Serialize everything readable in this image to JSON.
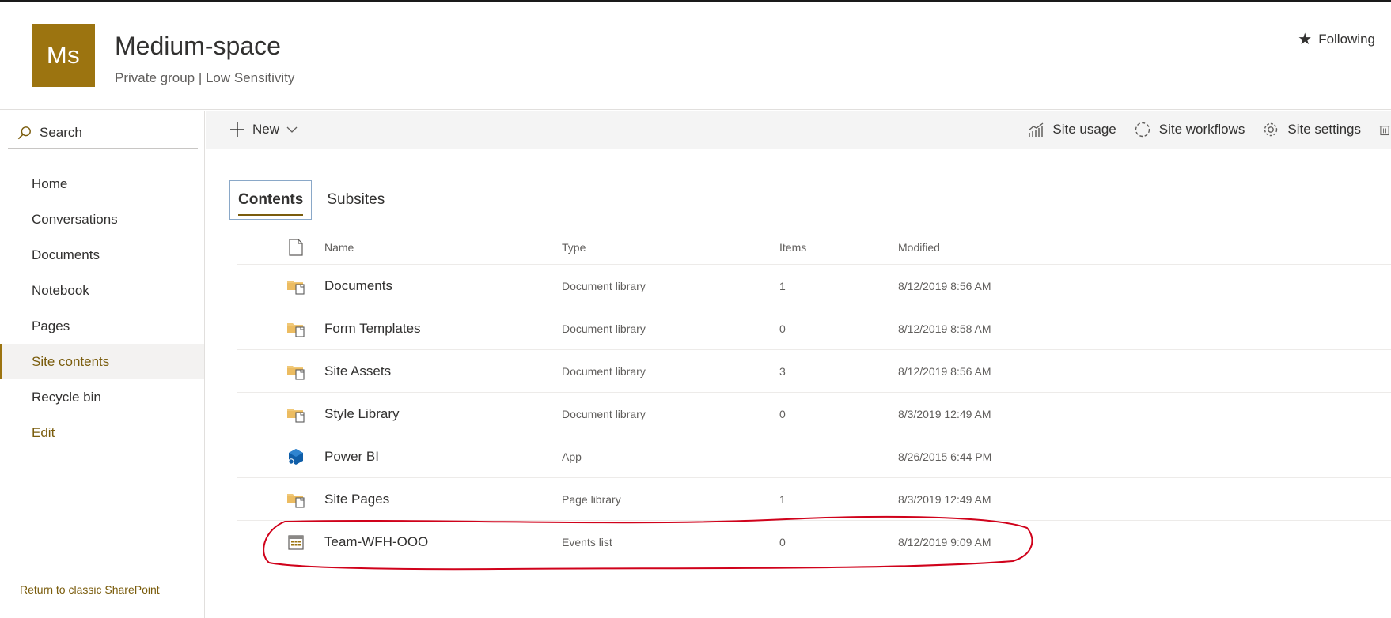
{
  "site": {
    "logo_text": "Ms",
    "title": "Medium-space",
    "subtitle": "Private group | Low Sensitivity",
    "follow_label": "Following",
    "accent_color": "#9c7410"
  },
  "leftnav": {
    "search_label": "Search",
    "items": [
      {
        "label": "Home"
      },
      {
        "label": "Conversations"
      },
      {
        "label": "Documents"
      },
      {
        "label": "Notebook"
      },
      {
        "label": "Pages"
      },
      {
        "label": "Site contents",
        "selected": true
      },
      {
        "label": "Recycle bin"
      },
      {
        "label": "Edit"
      }
    ],
    "return_link": "Return to classic SharePoint"
  },
  "commandbar": {
    "new_label": "New",
    "site_usage": "Site usage",
    "site_workflows": "Site workflows",
    "site_settings": "Site settings"
  },
  "tabs": [
    {
      "label": "Contents",
      "active": true
    },
    {
      "label": "Subsites",
      "active": false
    }
  ],
  "table": {
    "headers": {
      "name": "Name",
      "type": "Type",
      "items": "Items",
      "modified": "Modified"
    },
    "rows": [
      {
        "icon": "document-library-icon",
        "name": "Documents",
        "type": "Document library",
        "items": "1",
        "modified": "8/12/2019 8:56 AM"
      },
      {
        "icon": "document-library-icon",
        "name": "Form Templates",
        "type": "Document library",
        "items": "0",
        "modified": "8/12/2019 8:58 AM"
      },
      {
        "icon": "document-library-icon",
        "name": "Site Assets",
        "type": "Document library",
        "items": "3",
        "modified": "8/12/2019 8:56 AM"
      },
      {
        "icon": "document-library-icon",
        "name": "Style Library",
        "type": "Document library",
        "items": "0",
        "modified": "8/3/2019 12:49 AM"
      },
      {
        "icon": "app-icon",
        "name": "Power BI",
        "type": "App",
        "items": "",
        "modified": "8/26/2015 6:44 PM"
      },
      {
        "icon": "document-library-icon",
        "name": "Site Pages",
        "type": "Page library",
        "items": "1",
        "modified": "8/3/2019 12:49 AM"
      },
      {
        "icon": "events-list-icon",
        "name": "Team-WFH-OOO",
        "type": "Events list",
        "items": "0",
        "modified": "8/12/2019 9:09 AM"
      }
    ]
  },
  "annotation": {
    "color": "#d0021b"
  }
}
